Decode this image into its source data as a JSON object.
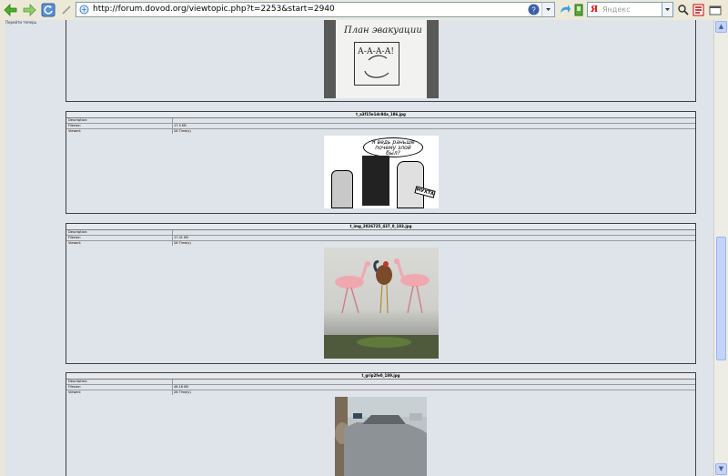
{
  "browser": {
    "url": "http://forum.dovod.org/viewtopic.php?t=2253&start=2940",
    "search_placeholder": "Яндекс"
  },
  "page": {
    "corner_label": "Перейти теперь"
  },
  "attachments": [
    {
      "filename": "",
      "description_label": "",
      "filesize_label": "",
      "viewed_label": "",
      "filesize": "",
      "viewed": "",
      "image": {
        "sign_title": "План эвакуации",
        "sign_text": "А-А-А-А!"
      }
    },
    {
      "filename": "t_a3f15e1dc94a_186.jpg",
      "description_label": "Description:",
      "filesize_label": "Filesize:",
      "viewed_label": "Viewed:",
      "filesize": "17.5 KB",
      "viewed": "28 Time(s)",
      "image": {
        "bubble_text": "Я ведь раньше почему злой был?",
        "sign_text": "МУХТА"
      }
    },
    {
      "filename": "t_img_2026725_437_0_183.jpg",
      "description_label": "Description:",
      "filesize_label": "Filesize:",
      "viewed_label": "Viewed:",
      "filesize": "17.41 KB",
      "viewed": "28 Time(s)",
      "image": {}
    },
    {
      "filename": "t_grip2fe0_189.jpg",
      "description_label": "Description:",
      "filesize_label": "Filesize:",
      "viewed_label": "Viewed:",
      "filesize": "46.16 KB",
      "viewed": "28 Time(s)",
      "image": {}
    }
  ]
}
